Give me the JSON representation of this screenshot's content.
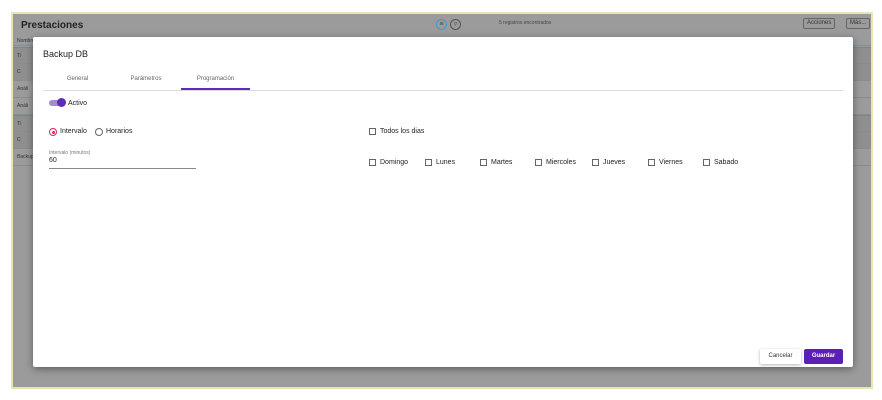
{
  "app": {
    "title": "Prestaciones",
    "records": "5 registros encontrados",
    "actions": "Acciones",
    "more": "Más...",
    "column": "Nombre",
    "rows": [
      "Ti",
      "C",
      "Análi",
      "Análi",
      "Ti",
      "C",
      "Backup"
    ]
  },
  "modal": {
    "title": "Backup DB",
    "tabs": [
      {
        "label": "General"
      },
      {
        "label": "Parámetros"
      },
      {
        "label": "Programación",
        "active": true
      }
    ],
    "active_toggle": {
      "label": "Activo",
      "on": true
    },
    "mode": {
      "options": [
        "Intervalo",
        "Horarios"
      ],
      "selected": "Intervalo"
    },
    "interval": {
      "label": "Intervalo (minutos)",
      "value": "60"
    },
    "all_days": {
      "label": "Todos los dias",
      "checked": false
    },
    "days": [
      {
        "label": "Domingo"
      },
      {
        "label": "Lunes"
      },
      {
        "label": "Martes"
      },
      {
        "label": "Miercoles"
      },
      {
        "label": "Jueves"
      },
      {
        "label": "Viernes"
      },
      {
        "label": "Sabado"
      }
    ],
    "cancel": "Cancelar",
    "save": "Guardar"
  },
  "colors": {
    "accent": "#5b1fb5",
    "radio": "#e0216b"
  }
}
